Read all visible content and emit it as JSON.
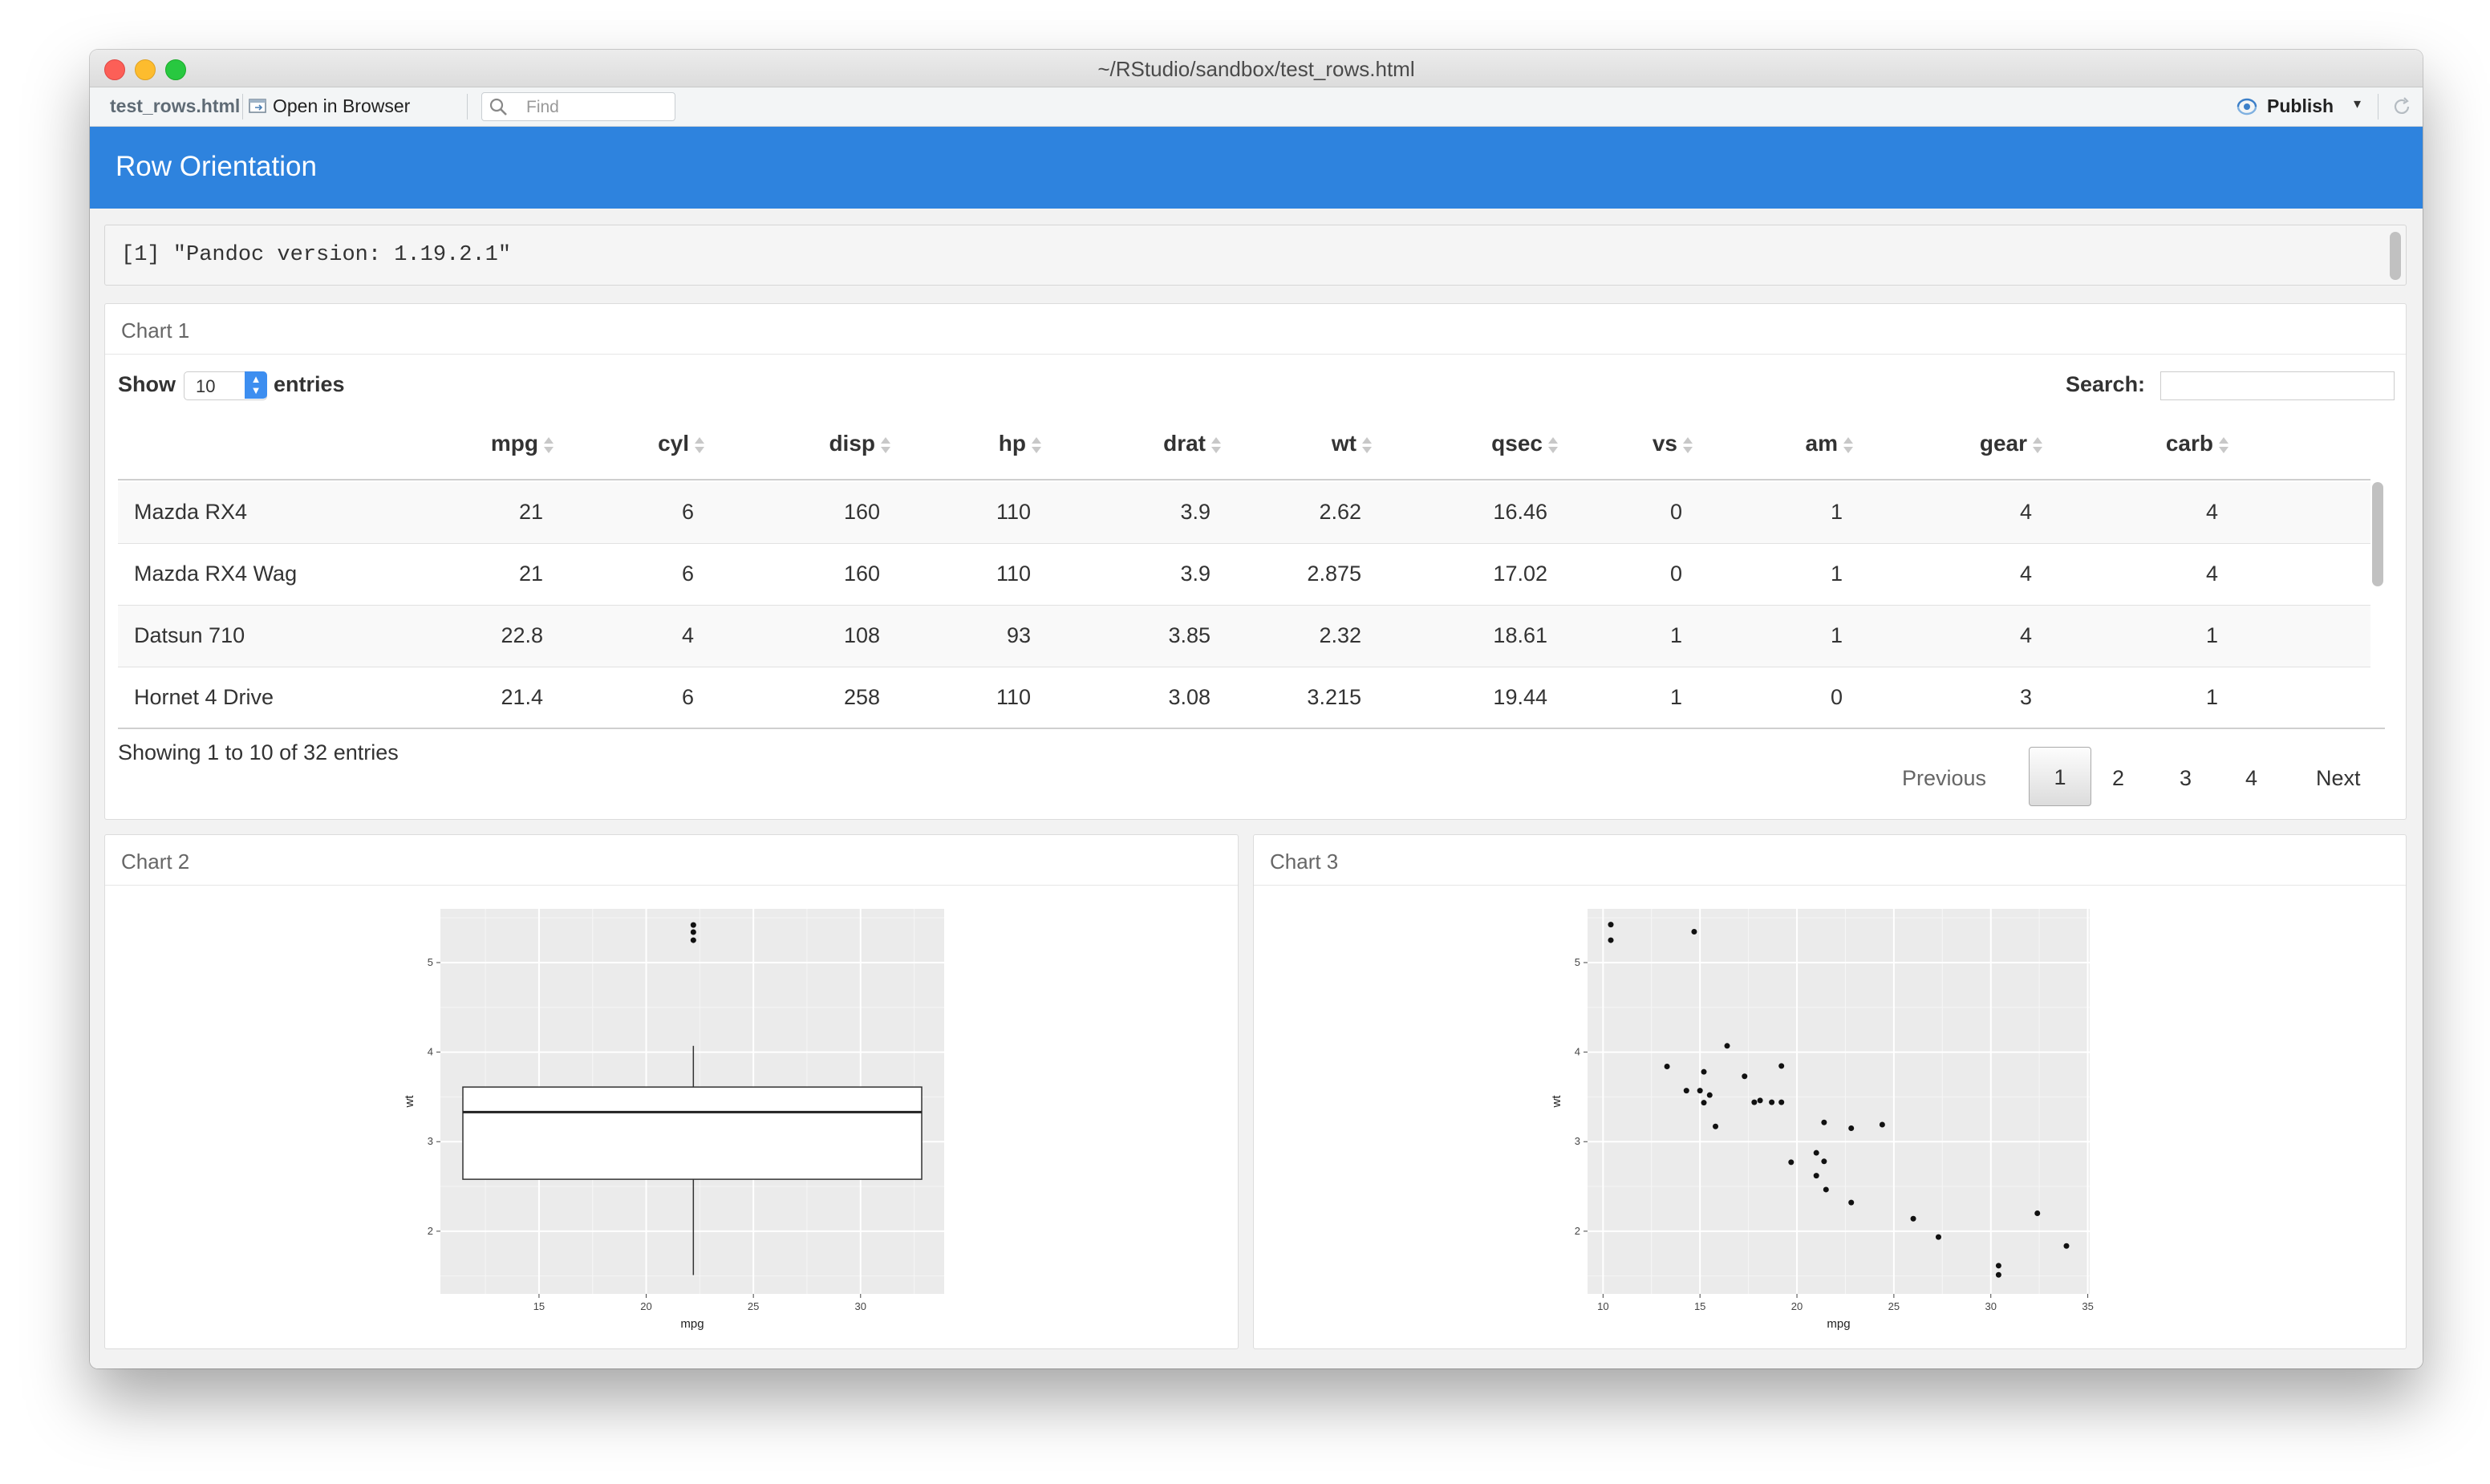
{
  "window": {
    "title": "~/RStudio/sandbox/test_rows.html"
  },
  "toolbar": {
    "file_tab": "test_rows.html",
    "open_in_browser": "Open in Browser",
    "find_placeholder": "Find",
    "publish_label": "Publish",
    "icons": [
      "open-in-browser-icon",
      "search-icon",
      "publish-icon",
      "chevron-down-icon",
      "refresh-icon"
    ]
  },
  "navbar": {
    "title": "Row Orientation",
    "color": "#2e83de"
  },
  "output": {
    "text": "[1] \"Pandoc version: 1.19.2.1\""
  },
  "chart1": {
    "title": "Chart 1",
    "show_label": "Show",
    "page_length": "10",
    "entries_label": "entries",
    "search_label": "Search:",
    "columns": [
      "mpg",
      "cyl",
      "disp",
      "hp",
      "drat",
      "wt",
      "qsec",
      "vs",
      "am",
      "gear",
      "carb"
    ],
    "rows": [
      {
        "name": "Mazda RX4",
        "values": [
          "21",
          "6",
          "160",
          "110",
          "3.9",
          "2.62",
          "16.46",
          "0",
          "1",
          "4",
          "4"
        ]
      },
      {
        "name": "Mazda RX4 Wag",
        "values": [
          "21",
          "6",
          "160",
          "110",
          "3.9",
          "2.875",
          "17.02",
          "0",
          "1",
          "4",
          "4"
        ]
      },
      {
        "name": "Datsun 710",
        "values": [
          "22.8",
          "4",
          "108",
          "93",
          "3.85",
          "2.32",
          "18.61",
          "1",
          "1",
          "4",
          "1"
        ]
      },
      {
        "name": "Hornet 4 Drive",
        "values": [
          "21.4",
          "6",
          "258",
          "110",
          "3.08",
          "3.215",
          "19.44",
          "1",
          "0",
          "3",
          "1"
        ]
      }
    ],
    "info": "Showing 1 to 10 of 32 entries",
    "pagination": {
      "previous": "Previous",
      "pages": [
        "1",
        "2",
        "3",
        "4"
      ],
      "current": "1",
      "next": "Next"
    }
  },
  "chart2": {
    "title": "Chart 2"
  },
  "chart3": {
    "title": "Chart 3"
  },
  "chart_data": [
    {
      "type": "boxplot",
      "xlabel": "mpg",
      "ylabel": "wt",
      "xlim": [
        10.4,
        33.9
      ],
      "ylim": [
        1.3,
        5.6
      ],
      "xticks": [
        15,
        20,
        25,
        30
      ],
      "yticks": [
        2,
        3,
        4,
        5
      ],
      "box": {
        "x_center": 22.2,
        "q1": 2.58,
        "median": 3.33,
        "q3": 3.61,
        "whisker_low": 1.51,
        "whisker_high": 4.07
      },
      "outliers": [
        5.25,
        5.34,
        5.42
      ],
      "grid": true,
      "background": "#ebebeb"
    },
    {
      "type": "scatter",
      "xlabel": "mpg",
      "ylabel": "wt",
      "xlim": [
        9.2,
        35.1
      ],
      "ylim": [
        1.3,
        5.6
      ],
      "xticks": [
        10,
        15,
        20,
        25,
        30,
        35
      ],
      "yticks": [
        2,
        3,
        4,
        5
      ],
      "points": [
        [
          21,
          2.62
        ],
        [
          21,
          2.875
        ],
        [
          22.8,
          2.32
        ],
        [
          21.4,
          3.215
        ],
        [
          18.7,
          3.44
        ],
        [
          18.1,
          3.46
        ],
        [
          14.3,
          3.57
        ],
        [
          24.4,
          3.19
        ],
        [
          22.8,
          3.15
        ],
        [
          19.2,
          3.44
        ],
        [
          17.8,
          3.44
        ],
        [
          16.4,
          4.07
        ],
        [
          17.3,
          3.73
        ],
        [
          15.2,
          3.78
        ],
        [
          10.4,
          5.25
        ],
        [
          10.4,
          5.424
        ],
        [
          14.7,
          5.345
        ],
        [
          32.4,
          2.2
        ],
        [
          30.4,
          1.615
        ],
        [
          33.9,
          1.835
        ],
        [
          21.5,
          2.465
        ],
        [
          15.5,
          3.52
        ],
        [
          15.2,
          3.435
        ],
        [
          13.3,
          3.84
        ],
        [
          19.2,
          3.845
        ],
        [
          27.3,
          1.935
        ],
        [
          26,
          2.14
        ],
        [
          30.4,
          1.513
        ],
        [
          15.8,
          3.17
        ],
        [
          19.7,
          2.77
        ],
        [
          15,
          3.57
        ],
        [
          21.4,
          2.78
        ]
      ],
      "grid": true,
      "background": "#ebebeb"
    }
  ]
}
